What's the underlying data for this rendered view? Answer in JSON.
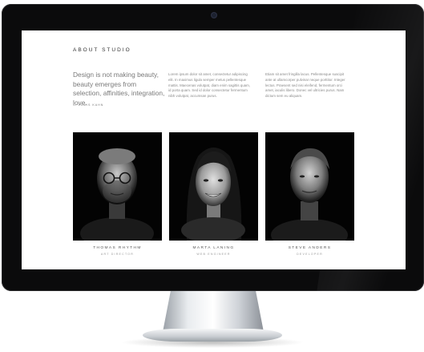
{
  "about": {
    "title": "ABOUT STUDIO",
    "quote": "Design is not making beauty, beauty emerges from selection, affinities, integration, love.",
    "quote_author": "— LOUIS KAHN"
  },
  "columns": [
    "Lorem ipsum dolor sit amet, consectetur adipiscing elit. In maximus ligula semper metus pellentesque mattis. Maecenas volutpat, diam enim sagittis quam, id porta quam. Sed id dolor consectetur fermentum nibh volutpat, accumsan purus.",
    "Etiam sit amet fringilla lacus. Pellentesque suscipit ante at ullamcorper pulvinar neque porttitor. Integer lectus. Praesent sed nisi eleifend, fermentum orci amet, iaculis libero. Donec vel ultricies purus. Nam dictum sem eu aliquam."
  ],
  "team": [
    {
      "name": "THOMAS RHYTHM",
      "role": "ART DIRECTOR"
    },
    {
      "name": "MARTA LANING",
      "role": "WEB ENGINEER"
    },
    {
      "name": "STEVE ANDERS",
      "role": "DEVELOPER"
    }
  ],
  "colors": {
    "bezel": "#0b0b0c",
    "screen": "#ffffff",
    "card_bg": "#030303"
  }
}
